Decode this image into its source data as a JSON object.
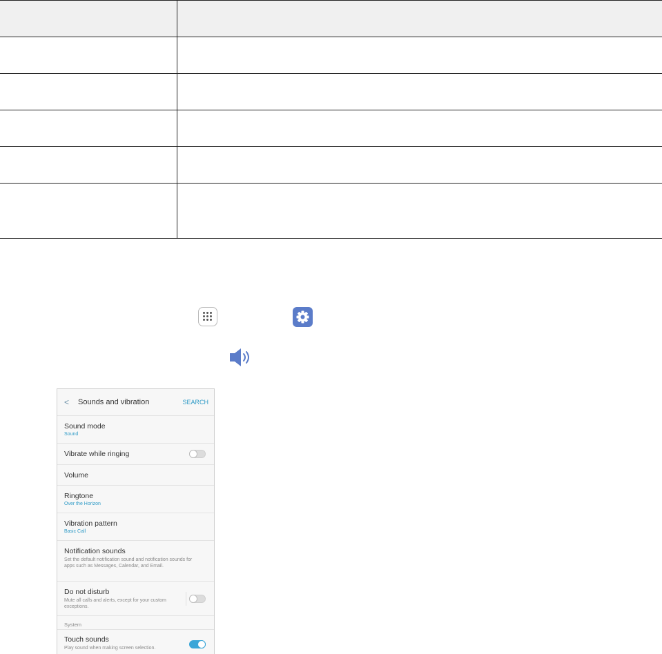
{
  "table": {
    "headers": [
      "",
      ""
    ],
    "rows": [
      [
        "",
        ""
      ],
      [
        "",
        ""
      ],
      [
        "",
        ""
      ],
      [
        "",
        ""
      ],
      [
        "",
        ""
      ]
    ]
  },
  "icons": {
    "apps": "apps-grid-icon",
    "settings": "gear-icon",
    "volume": "speaker-icon"
  },
  "phone": {
    "back_glyph": "<",
    "title": "Sounds and vibration",
    "search": "SEARCH",
    "items": [
      {
        "title": "Sound mode",
        "sub": "Sound"
      },
      {
        "title": "Vibrate while ringing",
        "toggle": false
      },
      {
        "title": "Volume"
      },
      {
        "title": "Ringtone",
        "sub": "Over the Horizon"
      },
      {
        "title": "Vibration pattern",
        "sub": "Basic Call"
      },
      {
        "title": "Notification sounds",
        "desc": "Set the default notification sound and notification sounds for apps such as Messages, Calendar, and Email."
      },
      {
        "title": "Do not disturb",
        "desc": "Mute all calls and alerts, except for your custom exceptions.",
        "toggle": false
      },
      {
        "title": "Touch sounds",
        "desc": "Play sound when making screen selection.",
        "toggle": true
      }
    ],
    "section_system": "System"
  },
  "colors": {
    "accent": "#2e9ac6",
    "toggle_on": "#3aa6d8",
    "settings_icon_bg": "#5b7cc9",
    "table_header_bg": "#f0f0f0"
  }
}
